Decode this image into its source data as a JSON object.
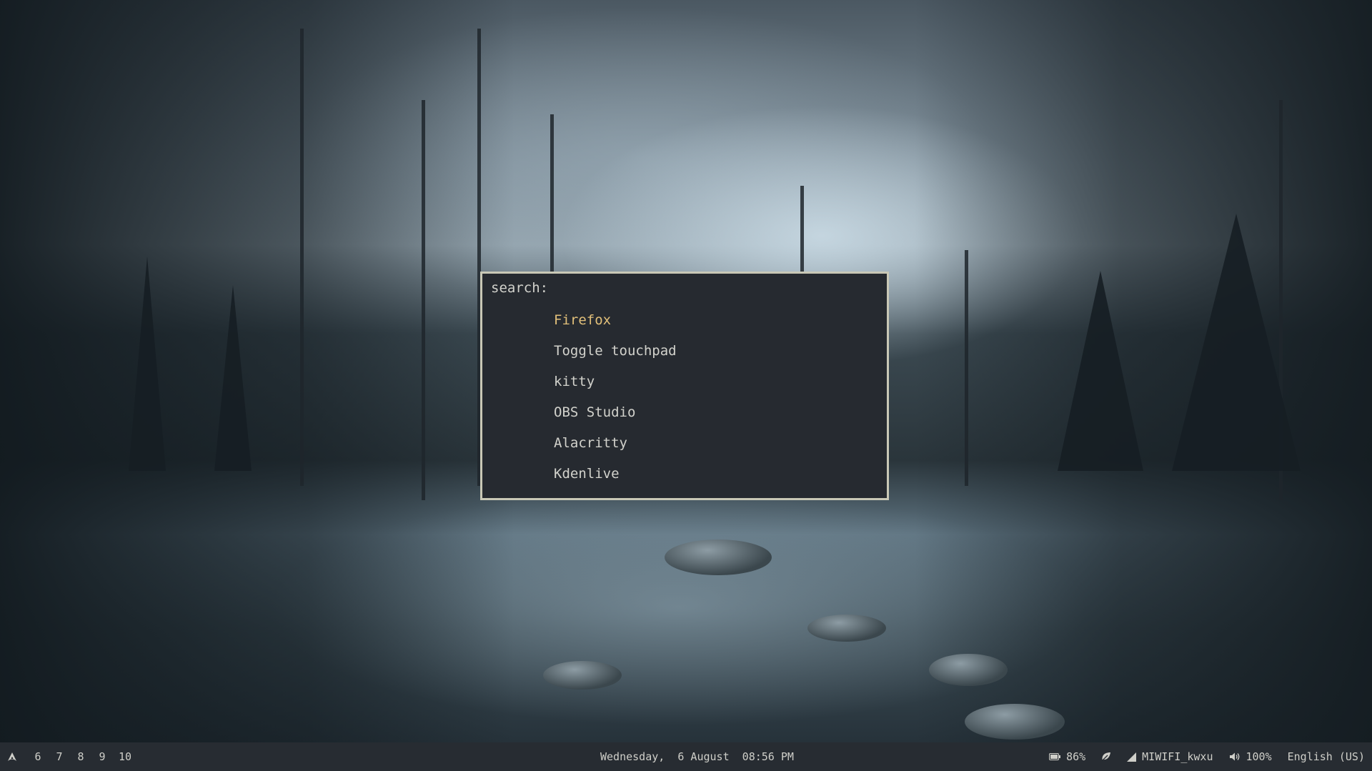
{
  "launcher": {
    "prompt": "search:",
    "query": "",
    "results": [
      {
        "label": "Firefox",
        "selected": true
      },
      {
        "label": "Toggle touchpad",
        "selected": false
      },
      {
        "label": "kitty",
        "selected": false
      },
      {
        "label": "OBS Studio",
        "selected": false
      },
      {
        "label": "Alacritty",
        "selected": false
      },
      {
        "label": "Kdenlive",
        "selected": false
      }
    ]
  },
  "bar": {
    "launcher_icon": "arch-icon",
    "workspaces": [
      "6",
      "7",
      "8",
      "9",
      "10"
    ],
    "datetime": "Wednesday,  6 August  08:56 PM",
    "battery": {
      "icon": "battery-icon",
      "label": "86%"
    },
    "power_profile": {
      "icon": "leaf-icon"
    },
    "network": {
      "icon": "wifi-signal-icon",
      "label": "MIWIFI_kwxu"
    },
    "volume": {
      "icon": "speaker-icon",
      "label": "100%"
    },
    "keyboard_layout": "English (US)"
  },
  "colors": {
    "accent": "#e2c07a",
    "launcher_bg": "#262a30",
    "launcher_border": "#c9c8b6",
    "bar_bg": "#272c32",
    "text": "#d2d2cc"
  }
}
